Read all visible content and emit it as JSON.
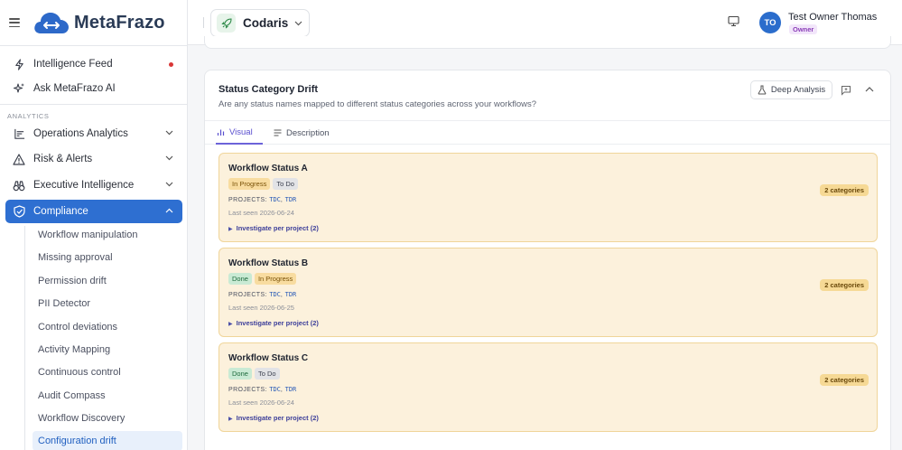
{
  "app": {
    "logo_text": "MetaFrazo"
  },
  "sidebar": {
    "top_items": [
      {
        "label": "Intelligence Feed",
        "icon": "bolt-icon"
      },
      {
        "label": "Ask MetaFrazo AI",
        "icon": "sparkles-icon"
      }
    ],
    "section_label": "ANALYTICS",
    "groups": [
      {
        "label": "Operations Analytics",
        "icon": "chart-icon"
      },
      {
        "label": "Risk & Alerts",
        "icon": "warning-icon"
      },
      {
        "label": "Executive Intelligence",
        "icon": "binoculars-icon"
      },
      {
        "label": "Compliance",
        "icon": "shield-icon"
      }
    ],
    "compliance_items": [
      "Workflow manipulation",
      "Missing approval",
      "Permission drift",
      "PII Detector",
      "Control deviations",
      "Activity Mapping",
      "Continuous control",
      "Audit Compass",
      "Workflow Discovery",
      "Configuration drift"
    ]
  },
  "topbar": {
    "project_name": "Codaris",
    "user": {
      "initials": "TO",
      "name": "Test Owner Thomas",
      "role": "Owner"
    }
  },
  "panel": {
    "title": "Status Category Drift",
    "subtitle": "Are any status names mapped to different status categories across your workflows?",
    "deep_analysis_label": "Deep Analysis",
    "tabs": [
      {
        "label": "Visual"
      },
      {
        "label": "Description"
      }
    ],
    "projects_prefix": "PROJECTS:",
    "statuses": [
      {
        "name": "Workflow Status A",
        "categories": [
          {
            "label": "In Progress",
            "kind": "inprogress"
          },
          {
            "label": "To Do",
            "kind": "todo"
          }
        ],
        "projects": [
          "TDC",
          "TDR"
        ],
        "last_seen": "Last seen 2026-06-24",
        "investigate": "Investigate per project (2)",
        "count_label": "2 categories"
      },
      {
        "name": "Workflow Status B",
        "categories": [
          {
            "label": "Done",
            "kind": "done"
          },
          {
            "label": "In Progress",
            "kind": "inprogress"
          }
        ],
        "projects": [
          "TDC",
          "TDR"
        ],
        "last_seen": "Last seen 2026-06-25",
        "investigate": "Investigate per project (2)",
        "count_label": "2 categories"
      },
      {
        "name": "Workflow Status C",
        "categories": [
          {
            "label": "Done",
            "kind": "done"
          },
          {
            "label": "To Do",
            "kind": "todo"
          }
        ],
        "projects": [
          "TDC",
          "TDR"
        ],
        "last_seen": "Last seen 2026-06-24",
        "investigate": "Investigate per project (2)",
        "count_label": "2 categories"
      }
    ]
  },
  "colors": {
    "accent": "#2e6fd1",
    "tab_active": "#6c63d9",
    "card_bg": "#fcf1dc",
    "card_border": "#f0d59a",
    "alert_dot": "#d93636"
  }
}
